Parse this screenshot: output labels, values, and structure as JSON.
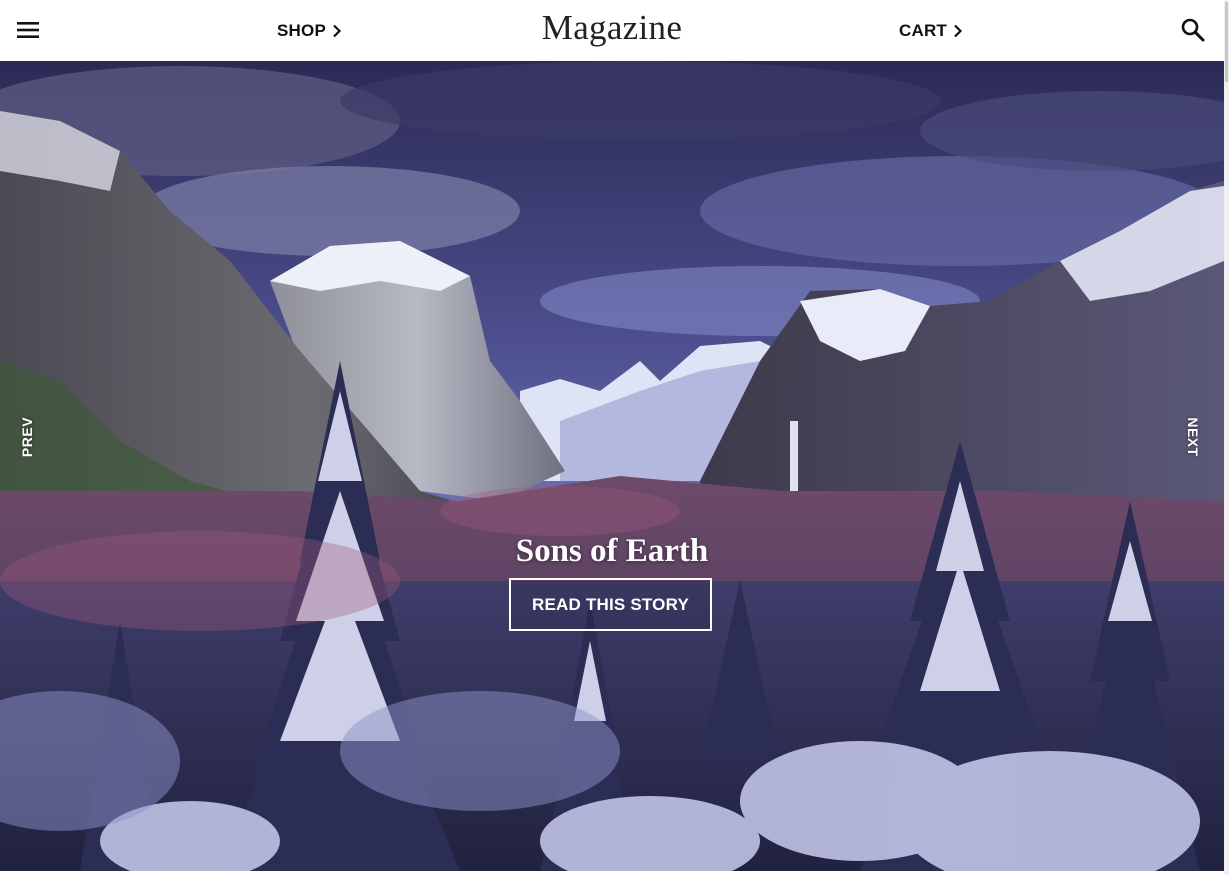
{
  "header": {
    "menu_icon": "hamburger-menu-icon",
    "shop_label": "SHOP",
    "brand": "Magazine",
    "cart_label": "CART",
    "search_icon": "search-icon",
    "chevron_icon": "chevron-right-icon"
  },
  "hero": {
    "prev_label": "PREV",
    "next_label": "NEXT",
    "story_title": "Sons of Earth",
    "story_button": "READ THIS STORY"
  },
  "colors": {
    "header_bg": "#ffffff",
    "text_dark": "#111111",
    "hero_text": "#ffffff",
    "sky": "#5a5fa0",
    "snow": "#e6e8f6"
  }
}
